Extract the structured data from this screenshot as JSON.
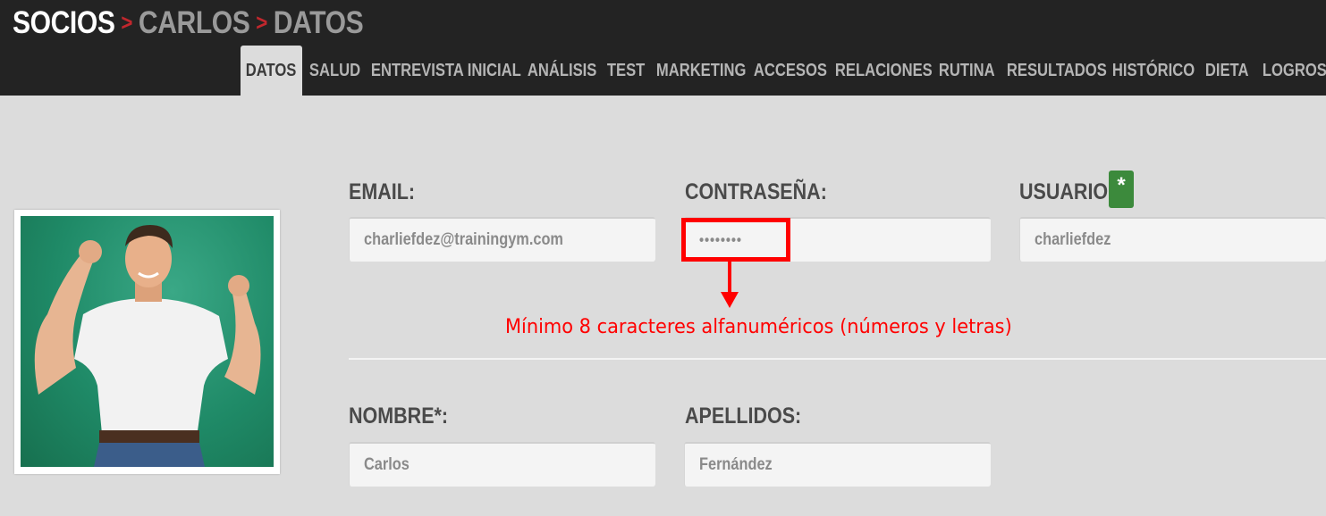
{
  "breadcrumb": {
    "root": "SOCIOS",
    "member": "CARLOS",
    "section": "DATOS",
    "separator": ">"
  },
  "tabs": [
    {
      "label": "DATOS",
      "active": true
    },
    {
      "label": "SALUD"
    },
    {
      "label": "ENTREVISTA INICIAL"
    },
    {
      "label": "ANÁLISIS"
    },
    {
      "label": "TEST"
    },
    {
      "label": "MARKETING"
    },
    {
      "label": "ACCESOS"
    },
    {
      "label": "RELACIONES"
    },
    {
      "label": "RUTINA"
    },
    {
      "label": "RESULTADOS"
    },
    {
      "label": "HISTÓRICO"
    },
    {
      "label": "DIETA"
    },
    {
      "label": "LOGROS"
    }
  ],
  "form": {
    "email": {
      "label": "EMAIL:",
      "value": "charliefdez@trainingym.com"
    },
    "password": {
      "label": "CONTRASEÑA:",
      "value": "••••••••"
    },
    "username": {
      "label": "USUARIO",
      "required_badge": "*",
      "value": "charliefdez"
    },
    "first_name": {
      "label": "NOMBRE*:",
      "value": "Carlos"
    },
    "last_name": {
      "label": "APELLIDOS:",
      "value": "Fernández"
    }
  },
  "annotation": {
    "text": "Mínimo 8 caracteres alfanuméricos (números y letras)"
  },
  "colors": {
    "topbar": "#232323",
    "accent_red": "#c1272d",
    "badge_green": "#3c8a3c",
    "annotation_red": "#ff0000"
  }
}
